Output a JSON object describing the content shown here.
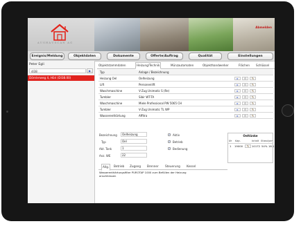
{
  "header": {
    "logout_label": "Abmelden",
    "logo_text": "AUSHAUSCAN AG"
  },
  "nav": {
    "buttons": [
      "Ereignis/Meldung",
      "Objektdaten",
      "Dokumente",
      "Offerte/Auftrag",
      "Qualität",
      "Einstellungen"
    ]
  },
  "sidebar": {
    "user": "Peter Egli",
    "search_value": "dl38",
    "search_button_icon": "arrow-right-icon",
    "selected_item": "Dörnlerweg 4, Höri (Dl38.00)"
  },
  "tabs": [
    "Objektstammdaten",
    "Heizung/Technik",
    "Münzautomaten",
    "Objekthandwerker",
    "Flächen",
    "Schlüssel"
  ],
  "active_tab": "Heizung/Technik",
  "grid": {
    "header": {
      "typ": "Typ",
      "bezeichnung": "Anlage / Bezeichnung"
    },
    "rows": [
      {
        "typ": "Heizung Oel",
        "bezeichnung": "Oelheizung"
      },
      {
        "typ": "Lift",
        "bezeichnung": "Personenlift"
      },
      {
        "typ": "Waschmaschine",
        "bezeichnung": "V-Zug Unimatic S (Re)"
      },
      {
        "typ": "Tumbler",
        "bezeichnung": "Sibir WT-TA"
      },
      {
        "typ": "Waschmaschine",
        "bezeichnung": "Miele Professional PW 5065 CH"
      },
      {
        "typ": "Tumbler",
        "bezeichnung": "V-Zug Unimatic TL WP"
      },
      {
        "typ": "Wasserenthärtung",
        "bezeichnung": "Affitra"
      }
    ]
  },
  "detail": {
    "bezeichnung_label": "Bezeichnung",
    "bezeichnung_value": "Oelheizung",
    "typ_label": "Typ",
    "typ_value": "Oel",
    "tank_label": "Akt. Tank",
    "tank_value": "1",
    "we_label": "Anz. WE",
    "we_value": "22",
    "aktiv_label": "Aktiv",
    "betrieb_label": "Betrieb",
    "bedienung_label": "Bedienung"
  },
  "bottom_tabs": [
    "Allg.",
    "Betrieb",
    "Zugang",
    "Brenner",
    "Steuerung",
    "Kessel"
  ],
  "note": "Wasserenthärtungsfilter PUROTAP 1000 zum Befüllen der Heizung anschliessen",
  "oeltanks": {
    "title": "Oeltänke",
    "headers": [
      "Nr",
      "Kap.",
      "Inhalt",
      "Stand",
      "per"
    ],
    "row": {
      "nr": "1",
      "kap": "19000",
      "inhalt": "10172",
      "stand": "54%",
      "per": "16.1"
    }
  }
}
